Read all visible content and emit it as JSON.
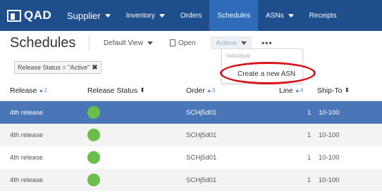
{
  "nav": {
    "logo": "QAD",
    "items": [
      {
        "label": "Supplier",
        "caret": true,
        "big": true
      },
      {
        "label": "Inventory",
        "caret": true,
        "big": false
      },
      {
        "label": "Orders",
        "caret": false,
        "big": false
      },
      {
        "label": "Schedules",
        "caret": false,
        "big": false,
        "active": true
      },
      {
        "label": "ASNs",
        "caret": true,
        "big": false
      },
      {
        "label": "Receipts",
        "caret": false,
        "big": false
      }
    ]
  },
  "toolbar": {
    "title": "Schedules",
    "view": "Default View",
    "open": "Open",
    "actions": "Actions",
    "more": "•••"
  },
  "dropdown": {
    "header": "Individual",
    "item": "Create a new ASN"
  },
  "filter": {
    "text": "Release Status = \"Active\"",
    "remove": "✖"
  },
  "table": {
    "columns": [
      {
        "label": "Release",
        "sort": "▲2"
      },
      {
        "label": "Release Status",
        "sort": "⬍"
      },
      {
        "label": "Order",
        "sort": "▲3"
      },
      {
        "label": "Line",
        "sort": "▲4"
      },
      {
        "label": "Ship-To",
        "sort": "⬍"
      }
    ],
    "rows": [
      {
        "release": "4th release",
        "status": "green",
        "order": "SCHj5d01",
        "line": "1",
        "ship_to": "10-100"
      },
      {
        "release": "4th release",
        "status": "green",
        "order": "SCHj5d01",
        "line": "1",
        "ship_to": "10-100"
      },
      {
        "release": "4th release",
        "status": "green",
        "order": "SCHj5d01",
        "line": "1",
        "ship_to": "10-100"
      },
      {
        "release": "4th release",
        "status": "green",
        "order": "SCHj5d01",
        "line": "1",
        "ship_to": "10-100"
      }
    ]
  },
  "colors": {
    "nav_bg": "#1f4e8c",
    "nav_active": "#2e6bb8",
    "selected_row": "#4a76b8",
    "status_green": "#6abf4b",
    "highlight_circle": "#d7151c"
  }
}
